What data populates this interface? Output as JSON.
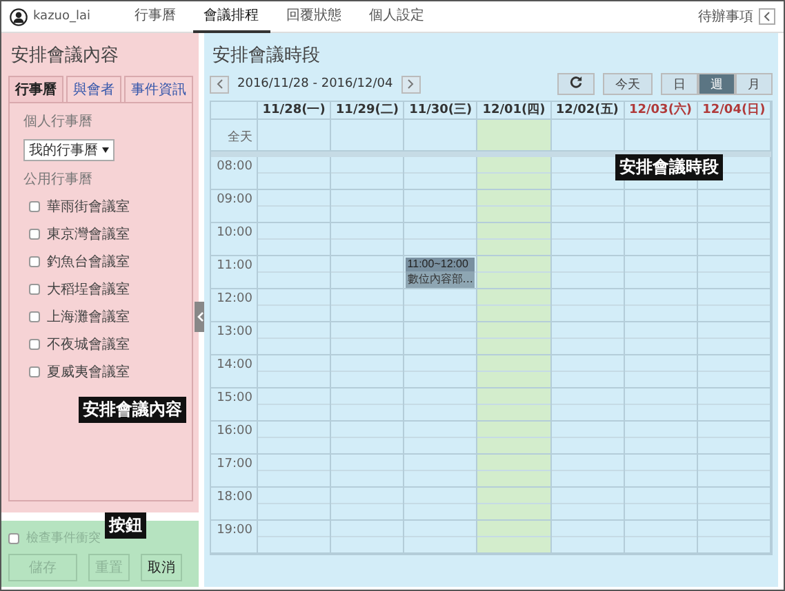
{
  "nav": {
    "user": "kazuo_lai",
    "tabs": [
      {
        "label": "行事曆",
        "selected": false
      },
      {
        "label": "會議排程",
        "selected": true
      },
      {
        "label": "回覆狀態",
        "selected": false
      },
      {
        "label": "個人設定",
        "selected": false
      }
    ],
    "todo_label": "待辦事項"
  },
  "left": {
    "title": "安排會議內容",
    "tabs": [
      {
        "label": "行事曆",
        "selected": true
      },
      {
        "label": "與會者",
        "selected": false
      },
      {
        "label": "事件資訊",
        "selected": false
      }
    ],
    "personal_label": "個人行事曆",
    "personal_select": "我的行事曆",
    "public_label": "公用行事曆",
    "rooms": [
      {
        "label": "華雨街會議室",
        "checked": false
      },
      {
        "label": "東京灣會議室",
        "checked": false
      },
      {
        "label": "釣魚台會議室",
        "checked": false
      },
      {
        "label": "大稻埕會議室",
        "checked": false
      },
      {
        "label": "上海灘會議室",
        "checked": false
      },
      {
        "label": "不夜城會議室",
        "checked": false
      },
      {
        "label": "夏威夷會議室",
        "checked": false
      }
    ],
    "annotation": "安排會議內容"
  },
  "footer": {
    "conflict_check": {
      "label": "檢查事件衝突",
      "checked": false,
      "disabled": true
    },
    "buttons": [
      {
        "label": "儲存",
        "disabled": true
      },
      {
        "label": "重置",
        "disabled": true
      },
      {
        "label": "取消",
        "disabled": false
      }
    ],
    "annotation": "按鈕"
  },
  "calendar": {
    "title": "安排會議時段",
    "range": "2016/11/28 - 2016/12/04",
    "today_label": "今天",
    "views": [
      {
        "label": "日",
        "selected": false
      },
      {
        "label": "週",
        "selected": true
      },
      {
        "label": "月",
        "selected": false
      }
    ],
    "days": [
      {
        "label": "11/28(一)",
        "weekend": false,
        "today": false
      },
      {
        "label": "11/29(二)",
        "weekend": false,
        "today": false
      },
      {
        "label": "11/30(三)",
        "weekend": false,
        "today": false,
        "events": [
          {
            "time": "11:00~12:00",
            "title": "數位內容部..."
          }
        ]
      },
      {
        "label": "12/01(四)",
        "weekend": false,
        "today": true
      },
      {
        "label": "12/02(五)",
        "weekend": false,
        "today": false
      },
      {
        "label": "12/03(六)",
        "weekend": true,
        "today": false
      },
      {
        "label": "12/04(日)",
        "weekend": true,
        "today": false
      }
    ],
    "allday_label": "全天",
    "hours": [
      "08:00",
      "09:00",
      "10:00",
      "11:00",
      "12:00",
      "13:00",
      "14:00",
      "15:00",
      "16:00",
      "17:00",
      "18:00",
      "19:00"
    ],
    "annotation": "安排會議時段"
  }
}
